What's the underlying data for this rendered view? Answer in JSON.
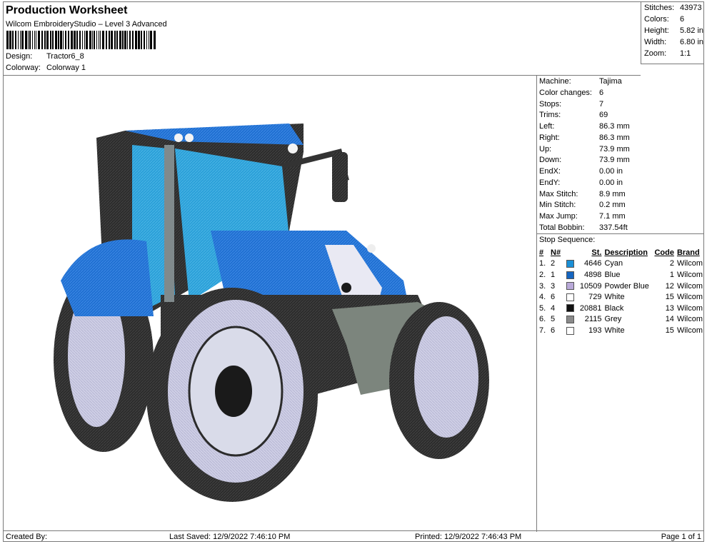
{
  "header": {
    "title": "Production Worksheet",
    "subtitle": "Wilcom EmbroideryStudio – Level 3 Advanced",
    "design_label": "Design:",
    "design_value": "Tractor6_8",
    "colorway_label": "Colorway:",
    "colorway_value": "Colorway 1"
  },
  "stats": [
    {
      "label": "Stitches:",
      "value": "43973"
    },
    {
      "label": "Colors:",
      "value": "6"
    },
    {
      "label": "Height:",
      "value": "5.82 in"
    },
    {
      "label": "Width:",
      "value": "6.80 in"
    },
    {
      "label": "Zoom:",
      "value": "1:1"
    }
  ],
  "details": [
    {
      "label": "Machine:",
      "value": "Tajima"
    },
    {
      "label": "Color changes:",
      "value": "6"
    },
    {
      "label": "Stops:",
      "value": "7"
    },
    {
      "label": "Trims:",
      "value": "69"
    },
    {
      "label": "Left:",
      "value": "86.3 mm"
    },
    {
      "label": "Right:",
      "value": "86.3 mm"
    },
    {
      "label": "Up:",
      "value": "73.9 mm"
    },
    {
      "label": "Down:",
      "value": "73.9 mm"
    },
    {
      "label": "EndX:",
      "value": "0.00 in"
    },
    {
      "label": "EndY:",
      "value": "0.00 in"
    },
    {
      "label": "Max Stitch:",
      "value": "8.9 mm"
    },
    {
      "label": "Min Stitch:",
      "value": "0.2 mm"
    },
    {
      "label": "Max Jump:",
      "value": "7.1 mm"
    },
    {
      "label": "Total Bobbin:",
      "value": "337.54ft"
    }
  ],
  "stop_sequence": {
    "label": "Stop Sequence:",
    "headers": {
      "num": "#",
      "n": "N#",
      "st": "St.",
      "desc": "Description",
      "code": "Code",
      "brand": "Brand"
    },
    "rows": [
      {
        "num": "1.",
        "n": "2",
        "color": "#1a8fd6",
        "st": "4646",
        "desc": "Cyan",
        "code": "2",
        "brand": "Wilcom"
      },
      {
        "num": "2.",
        "n": "1",
        "color": "#1565c0",
        "st": "4898",
        "desc": "Blue",
        "code": "1",
        "brand": "Wilcom"
      },
      {
        "num": "3.",
        "n": "3",
        "color": "#b9a9d9",
        "st": "10509",
        "desc": "Powder Blue",
        "code": "12",
        "brand": "Wilcom"
      },
      {
        "num": "4.",
        "n": "6",
        "color": "#ffffff",
        "st": "729",
        "desc": "White",
        "code": "15",
        "brand": "Wilcom"
      },
      {
        "num": "5.",
        "n": "4",
        "color": "#111111",
        "st": "20881",
        "desc": "Black",
        "code": "13",
        "brand": "Wilcom"
      },
      {
        "num": "6.",
        "n": "5",
        "color": "#8a8a8a",
        "st": "2115",
        "desc": "Grey",
        "code": "14",
        "brand": "Wilcom"
      },
      {
        "num": "7.",
        "n": "6",
        "color": "#ffffff",
        "st": "193",
        "desc": "White",
        "code": "15",
        "brand": "Wilcom"
      }
    ]
  },
  "footer": {
    "created": "Created By:",
    "saved": "Last Saved: 12/9/2022 7:46:10 PM",
    "printed": "Printed: 12/9/2022 7:46:43 PM",
    "page": "Page 1 of 1"
  }
}
